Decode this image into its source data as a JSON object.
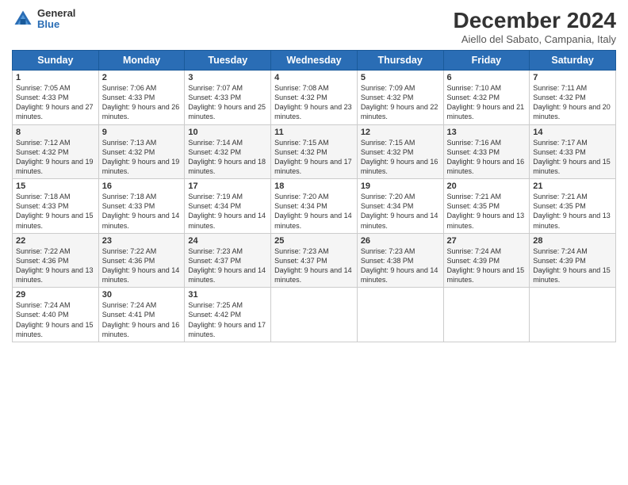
{
  "logo": {
    "general": "General",
    "blue": "Blue"
  },
  "title": "December 2024",
  "subtitle": "Aiello del Sabato, Campania, Italy",
  "days": [
    "Sunday",
    "Monday",
    "Tuesday",
    "Wednesday",
    "Thursday",
    "Friday",
    "Saturday"
  ],
  "weeks": [
    [
      {
        "day": 1,
        "sunrise": "7:05 AM",
        "sunset": "4:33 PM",
        "daylight": "9 hours and 27 minutes."
      },
      {
        "day": 2,
        "sunrise": "7:06 AM",
        "sunset": "4:33 PM",
        "daylight": "9 hours and 26 minutes."
      },
      {
        "day": 3,
        "sunrise": "7:07 AM",
        "sunset": "4:33 PM",
        "daylight": "9 hours and 25 minutes."
      },
      {
        "day": 4,
        "sunrise": "7:08 AM",
        "sunset": "4:32 PM",
        "daylight": "9 hours and 23 minutes."
      },
      {
        "day": 5,
        "sunrise": "7:09 AM",
        "sunset": "4:32 PM",
        "daylight": "9 hours and 22 minutes."
      },
      {
        "day": 6,
        "sunrise": "7:10 AM",
        "sunset": "4:32 PM",
        "daylight": "9 hours and 21 minutes."
      },
      {
        "day": 7,
        "sunrise": "7:11 AM",
        "sunset": "4:32 PM",
        "daylight": "9 hours and 20 minutes."
      }
    ],
    [
      {
        "day": 8,
        "sunrise": "7:12 AM",
        "sunset": "4:32 PM",
        "daylight": "9 hours and 19 minutes."
      },
      {
        "day": 9,
        "sunrise": "7:13 AM",
        "sunset": "4:32 PM",
        "daylight": "9 hours and 19 minutes."
      },
      {
        "day": 10,
        "sunrise": "7:14 AM",
        "sunset": "4:32 PM",
        "daylight": "9 hours and 18 minutes."
      },
      {
        "day": 11,
        "sunrise": "7:15 AM",
        "sunset": "4:32 PM",
        "daylight": "9 hours and 17 minutes."
      },
      {
        "day": 12,
        "sunrise": "7:15 AM",
        "sunset": "4:32 PM",
        "daylight": "9 hours and 16 minutes."
      },
      {
        "day": 13,
        "sunrise": "7:16 AM",
        "sunset": "4:33 PM",
        "daylight": "9 hours and 16 minutes."
      },
      {
        "day": 14,
        "sunrise": "7:17 AM",
        "sunset": "4:33 PM",
        "daylight": "9 hours and 15 minutes."
      }
    ],
    [
      {
        "day": 15,
        "sunrise": "7:18 AM",
        "sunset": "4:33 PM",
        "daylight": "9 hours and 15 minutes."
      },
      {
        "day": 16,
        "sunrise": "7:18 AM",
        "sunset": "4:33 PM",
        "daylight": "9 hours and 14 minutes."
      },
      {
        "day": 17,
        "sunrise": "7:19 AM",
        "sunset": "4:34 PM",
        "daylight": "9 hours and 14 minutes."
      },
      {
        "day": 18,
        "sunrise": "7:20 AM",
        "sunset": "4:34 PM",
        "daylight": "9 hours and 14 minutes."
      },
      {
        "day": 19,
        "sunrise": "7:20 AM",
        "sunset": "4:34 PM",
        "daylight": "9 hours and 14 minutes."
      },
      {
        "day": 20,
        "sunrise": "7:21 AM",
        "sunset": "4:35 PM",
        "daylight": "9 hours and 13 minutes."
      },
      {
        "day": 21,
        "sunrise": "7:21 AM",
        "sunset": "4:35 PM",
        "daylight": "9 hours and 13 minutes."
      }
    ],
    [
      {
        "day": 22,
        "sunrise": "7:22 AM",
        "sunset": "4:36 PM",
        "daylight": "9 hours and 13 minutes."
      },
      {
        "day": 23,
        "sunrise": "7:22 AM",
        "sunset": "4:36 PM",
        "daylight": "9 hours and 14 minutes."
      },
      {
        "day": 24,
        "sunrise": "7:23 AM",
        "sunset": "4:37 PM",
        "daylight": "9 hours and 14 minutes."
      },
      {
        "day": 25,
        "sunrise": "7:23 AM",
        "sunset": "4:37 PM",
        "daylight": "9 hours and 14 minutes."
      },
      {
        "day": 26,
        "sunrise": "7:23 AM",
        "sunset": "4:38 PM",
        "daylight": "9 hours and 14 minutes."
      },
      {
        "day": 27,
        "sunrise": "7:24 AM",
        "sunset": "4:39 PM",
        "daylight": "9 hours and 15 minutes."
      },
      {
        "day": 28,
        "sunrise": "7:24 AM",
        "sunset": "4:39 PM",
        "daylight": "9 hours and 15 minutes."
      }
    ],
    [
      {
        "day": 29,
        "sunrise": "7:24 AM",
        "sunset": "4:40 PM",
        "daylight": "9 hours and 15 minutes."
      },
      {
        "day": 30,
        "sunrise": "7:24 AM",
        "sunset": "4:41 PM",
        "daylight": "9 hours and 16 minutes."
      },
      {
        "day": 31,
        "sunrise": "7:25 AM",
        "sunset": "4:42 PM",
        "daylight": "9 hours and 17 minutes."
      },
      null,
      null,
      null,
      null
    ]
  ]
}
